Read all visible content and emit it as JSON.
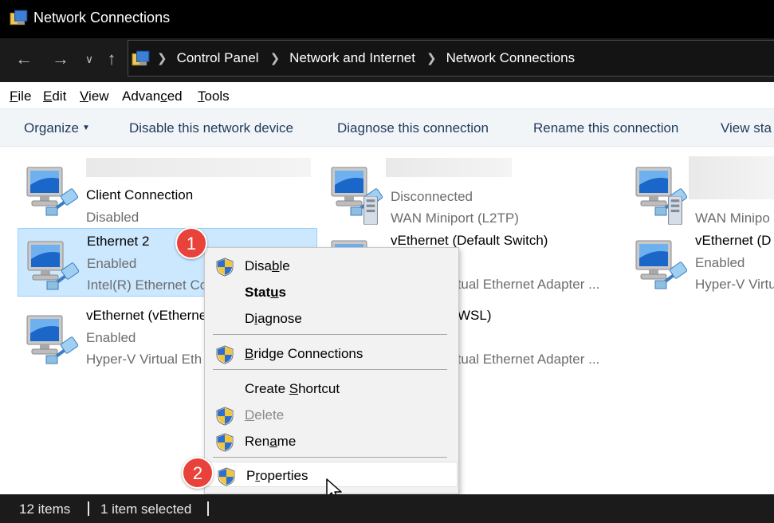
{
  "window": {
    "title": "Network Connections"
  },
  "nav": {
    "breadcrumbs": [
      "Control Panel",
      "Network and Internet",
      "Network Connections"
    ]
  },
  "menubar": {
    "items": [
      {
        "label": "File",
        "accel": "F",
        "rest": "ile"
      },
      {
        "label": "Edit",
        "accel": "E",
        "rest": "dit"
      },
      {
        "label": "View",
        "accel": "V",
        "rest": "iew"
      },
      {
        "label": "Advanced",
        "pre": "Advan",
        "accel": "c",
        "rest": "ed"
      },
      {
        "label": "Tools",
        "accel": "T",
        "rest": "ools"
      }
    ]
  },
  "toolbar": {
    "organize": "Organize",
    "disable": "Disable this network device",
    "diagnose": "Diagnose this connection",
    "rename": "Rename this connection",
    "view_status": "View sta"
  },
  "items": [
    {
      "name": "Client Connection",
      "status": "Disabled",
      "device": ""
    },
    {
      "name": "",
      "status": "Disconnected",
      "device": "WAN Miniport (L2TP)"
    },
    {
      "name": "",
      "status": "",
      "device": "WAN Minipo"
    },
    {
      "name": "Ethernet 2",
      "status": "Enabled",
      "device": "Intel(R) Ethernet Co"
    },
    {
      "name": "vEthernet (Default Switch)",
      "status": "",
      "device": "rtual Ethernet Adapter ..."
    },
    {
      "name": "vEthernet (D",
      "status": "Enabled",
      "device": "Hyper-V Virtu"
    },
    {
      "name": "vEthernet (vEtherne",
      "status": "Enabled",
      "device": "Hyper-V Virtual Eth"
    },
    {
      "name": "WSL)",
      "status": "",
      "device": "rtual Ethernet Adapter ..."
    }
  ],
  "context_menu": {
    "disable": {
      "pre": "Disa",
      "accel": "b",
      "rest": "le"
    },
    "status": {
      "pre": "Stat",
      "accel": "u",
      "rest": "s"
    },
    "diagnose": {
      "pre": "D",
      "accel": "i",
      "rest": "agnose"
    },
    "bridge": {
      "pre": "",
      "accel": "B",
      "rest": "ridge Connections"
    },
    "shortcut": {
      "pre": "Create ",
      "accel": "S",
      "rest": "hortcut"
    },
    "delete": {
      "pre": "",
      "accel": "D",
      "rest": "elete"
    },
    "rename": {
      "pre": "Ren",
      "accel": "a",
      "rest": "me"
    },
    "properties": {
      "pre": "P",
      "accel": "r",
      "rest": "operties"
    }
  },
  "badges": [
    "1",
    "2"
  ],
  "statusbar": {
    "count": "12 items",
    "selected": "1 item selected"
  },
  "colors": {
    "selection": "#cce8ff",
    "badge": "#e8423a",
    "titlebar": "#000000"
  },
  "icons": [
    "network-connections-icon",
    "back-arrow-icon",
    "forward-arrow-icon",
    "up-arrow-icon",
    "network-adapter-icon",
    "uac-shield-icon",
    "mouse-cursor-icon"
  ]
}
